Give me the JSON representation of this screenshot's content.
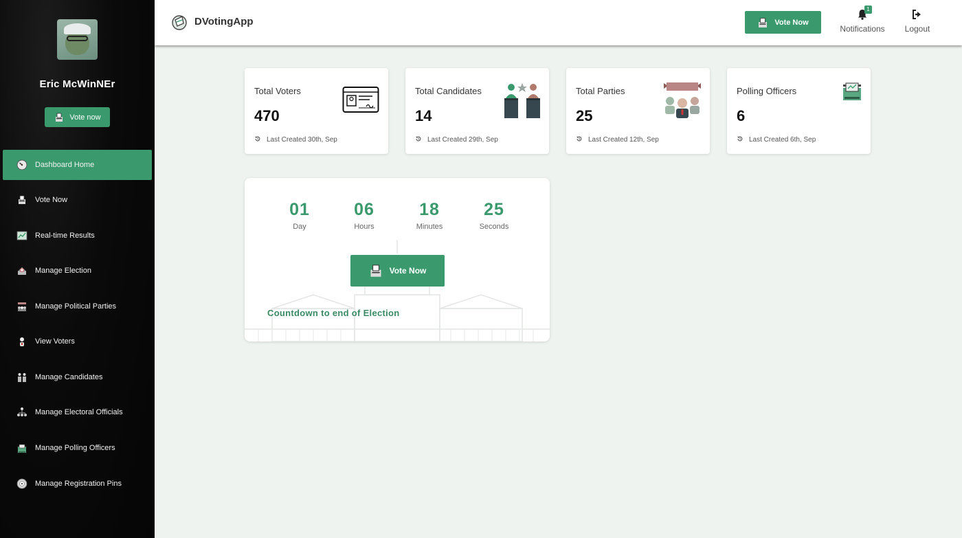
{
  "app": {
    "title": "DVotingApp"
  },
  "header": {
    "vote_button": "Vote Now",
    "notifications_label": "Notifications",
    "notifications_count": "1",
    "logout_label": "Logout"
  },
  "sidebar": {
    "user_name": "Eric McWinNEr",
    "vote_button": "Vote now",
    "items": [
      {
        "label": "Dashboard Home",
        "icon": "dashboard-gauge-icon",
        "active": true
      },
      {
        "label": "Vote Now",
        "icon": "ballot-box-icon"
      },
      {
        "label": "Real-time Results",
        "icon": "results-chart-icon"
      },
      {
        "label": "Manage Election",
        "icon": "election-icon"
      },
      {
        "label": "Manage Political Parties",
        "icon": "parties-icon"
      },
      {
        "label": "View Voters",
        "icon": "voter-icon"
      },
      {
        "label": "Manage Candidates",
        "icon": "candidates-icon"
      },
      {
        "label": "Manage Electoral Officials",
        "icon": "officials-icon"
      },
      {
        "label": "Manage Polling Officers",
        "icon": "polling-officer-icon"
      },
      {
        "label": "Manage Registration Pins",
        "icon": "pin-icon"
      }
    ]
  },
  "stats": [
    {
      "label": "Total Voters",
      "value": "470",
      "meta": "Last Created 30th, Sep",
      "icon": "id-card-icon"
    },
    {
      "label": "Total Candidates",
      "value": "14",
      "meta": "Last Created 29th, Sep",
      "icon": "candidates-podium-icon"
    },
    {
      "label": "Total Parties",
      "value": "25",
      "meta": "Last Created 12th, Sep",
      "icon": "party-banner-icon"
    },
    {
      "label": "Polling Officers",
      "value": "6",
      "meta": "Last Created 6th, Sep",
      "icon": "polling-officer-icon"
    }
  ],
  "countdown": {
    "units": [
      {
        "value": "01",
        "label": "Day"
      },
      {
        "value": "06",
        "label": "Hours"
      },
      {
        "value": "18",
        "label": "Minutes"
      },
      {
        "value": "25",
        "label": "Seconds"
      }
    ],
    "button": "Vote Now",
    "caption": "Countdown to end of Election"
  },
  "colors": {
    "accent": "#3a9a6d",
    "sidebar_bg": "#0a0a0a",
    "page_bg": "#eef3ef"
  }
}
